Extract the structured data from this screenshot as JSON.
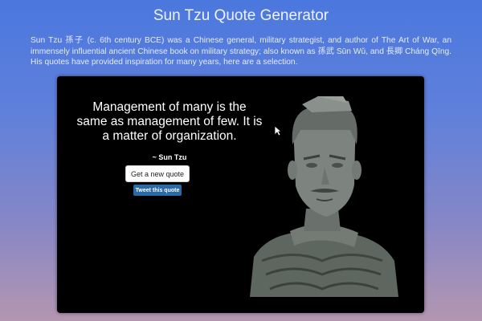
{
  "header": {
    "title": "Sun Tzu Quote Generator"
  },
  "intro": {
    "text": "Sun Tzu 孫子 (c. 6th century BCE) was a Chinese general, military strategist, and author of The Art of War, an immensely influential ancient Chinese book on military strategy; also known as 孫武 Sūn Wǔ, and 長卿 Cháng Qīng. His quotes have provided inspiration for many years, here are a selection."
  },
  "quote": {
    "text": "Management of many is the same as management of few. It is a matter of organization.",
    "author": "~ Sun Tzu"
  },
  "buttons": {
    "new_quote": "Get a new quote",
    "tweet": "Tweet this quote"
  },
  "image": {
    "subject": "terracotta warrior statue",
    "icon": "statue-image"
  },
  "colors": {
    "background_top": "#4b78de",
    "background_bottom": "#b496b0",
    "card": "#000000",
    "tweet_button": "#2b6aa8",
    "new_quote_button": "#ffffff"
  }
}
